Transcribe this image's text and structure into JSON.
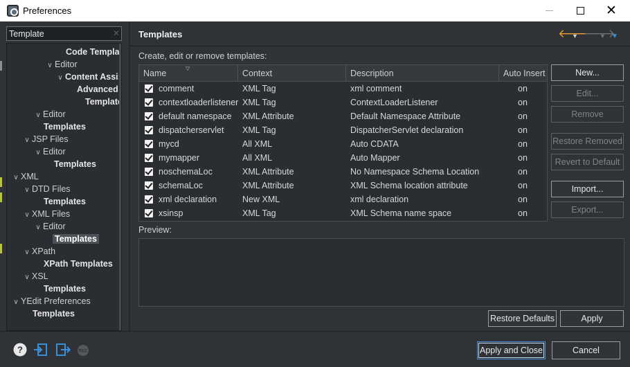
{
  "window": {
    "title": "Preferences"
  },
  "filter": {
    "value": "Template",
    "clear_icon": "clear-icon"
  },
  "tree": [
    {
      "label": "Code Templa",
      "bold": true,
      "arrow": "",
      "selected": false
    },
    {
      "label": "Editor",
      "bold": false,
      "arrow": "down",
      "selected": false
    },
    {
      "label": "Content Assi:",
      "bold": true,
      "arrow": "down",
      "selected": false
    },
    {
      "label": "Advanced",
      "bold": true,
      "arrow": "",
      "selected": false
    },
    {
      "label": "Templates",
      "bold": true,
      "arrow": "",
      "selected": false
    },
    {
      "label": "Editor",
      "bold": false,
      "arrow": "down",
      "selected": false
    },
    {
      "label": "Templates",
      "bold": true,
      "arrow": "",
      "selected": false
    },
    {
      "label": "JSP Files",
      "bold": false,
      "arrow": "down",
      "selected": false
    },
    {
      "label": "Editor",
      "bold": false,
      "arrow": "down",
      "selected": false
    },
    {
      "label": "Templates",
      "bold": true,
      "arrow": "",
      "selected": false
    },
    {
      "label": "XML",
      "bold": false,
      "arrow": "down",
      "selected": false
    },
    {
      "label": "DTD Files",
      "bold": false,
      "arrow": "down",
      "selected": false
    },
    {
      "label": "Templates",
      "bold": true,
      "arrow": "",
      "selected": false
    },
    {
      "label": "XML Files",
      "bold": false,
      "arrow": "down",
      "selected": false
    },
    {
      "label": "Editor",
      "bold": false,
      "arrow": "down",
      "selected": false
    },
    {
      "label": "Templates",
      "bold": true,
      "arrow": "",
      "selected": true
    },
    {
      "label": "XPath",
      "bold": false,
      "arrow": "down",
      "selected": false
    },
    {
      "label": "XPath Templates",
      "bold": true,
      "arrow": "",
      "selected": false
    },
    {
      "label": "XSL",
      "bold": false,
      "arrow": "down",
      "selected": false
    },
    {
      "label": "Templates",
      "bold": true,
      "arrow": "",
      "selected": false
    },
    {
      "label": "YEdit Preferences",
      "bold": false,
      "arrow": "down",
      "selected": false
    },
    {
      "label": "Templates",
      "bold": true,
      "arrow": "",
      "selected": false
    }
  ],
  "page": {
    "title": "Templates",
    "subtitle": "Create, edit or remove templates:",
    "preview_label": "Preview:"
  },
  "table": {
    "columns": [
      "Name",
      "Context",
      "Description",
      "Auto Insert"
    ],
    "rows": [
      {
        "checked": true,
        "name": "comment",
        "context": "XML Tag",
        "description": "xml comment",
        "auto": "on"
      },
      {
        "checked": true,
        "name": "contextloaderlistener",
        "context": "XML Tag",
        "description": "ContextLoaderListener",
        "auto": "on"
      },
      {
        "checked": true,
        "name": "default namespace",
        "context": "XML Attribute",
        "description": "Default Namespace Attribute",
        "auto": "on"
      },
      {
        "checked": true,
        "name": "dispatcherservlet",
        "context": "XML Tag",
        "description": "DispatcherServlet declaration",
        "auto": "on"
      },
      {
        "checked": true,
        "name": "mycd",
        "context": "All XML",
        "description": "Auto CDATA",
        "auto": "on"
      },
      {
        "checked": true,
        "name": "mymapper",
        "context": "All XML",
        "description": "Auto Mapper",
        "auto": "on"
      },
      {
        "checked": true,
        "name": "noschemaLoc",
        "context": "XML Attribute",
        "description": "No Namespace Schema Location",
        "auto": "on"
      },
      {
        "checked": true,
        "name": "schemaLoc",
        "context": "XML Attribute",
        "description": "XML Schema location attribute",
        "auto": "on"
      },
      {
        "checked": true,
        "name": "xml declaration",
        "context": "New XML",
        "description": "xml declaration",
        "auto": "on"
      },
      {
        "checked": true,
        "name": "xsinsp",
        "context": "XML Tag",
        "description": "XML Schema name space",
        "auto": "on"
      }
    ]
  },
  "buttons": {
    "new": "New...",
    "edit": "Edit...",
    "remove": "Remove",
    "restore_removed": "Restore Removed",
    "revert_default": "Revert to Default",
    "import": "Import...",
    "export": "Export...",
    "restore_defaults": "Restore Defaults",
    "apply": "Apply",
    "apply_close": "Apply and Close",
    "cancel": "Cancel"
  },
  "colors": {
    "accent_orange": "#f0a030",
    "accent_blue": "#3b8fd6",
    "background": "#2f3338"
  }
}
